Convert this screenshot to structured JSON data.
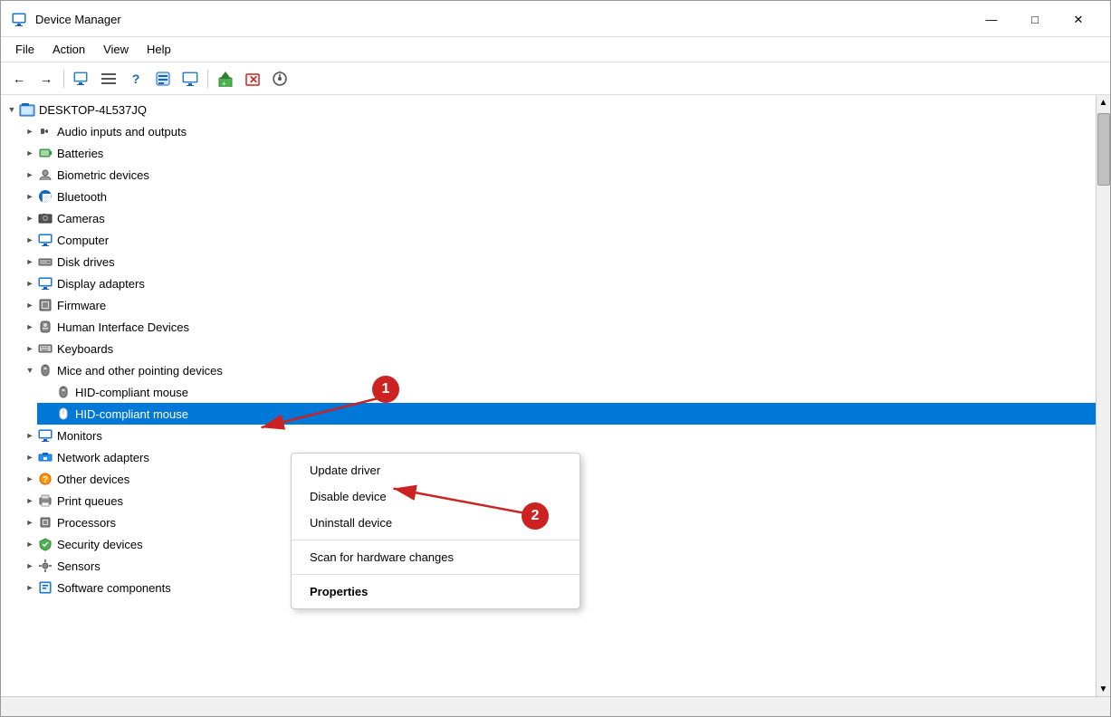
{
  "window": {
    "title": "Device Manager",
    "controls": {
      "minimize": "—",
      "maximize": "□",
      "close": "✕"
    }
  },
  "menu": {
    "items": [
      "File",
      "Action",
      "View",
      "Help"
    ]
  },
  "tree": {
    "root": "DESKTOP-4L537JQ",
    "items": [
      {
        "id": "audio",
        "label": "Audio inputs and outputs",
        "level": 1,
        "expanded": false,
        "icon": "🔊"
      },
      {
        "id": "batteries",
        "label": "Batteries",
        "level": 1,
        "expanded": false,
        "icon": "🔋"
      },
      {
        "id": "biometric",
        "label": "Biometric devices",
        "level": 1,
        "expanded": false,
        "icon": "🖐"
      },
      {
        "id": "bluetooth",
        "label": "Bluetooth",
        "level": 1,
        "expanded": false,
        "icon": "🔵"
      },
      {
        "id": "cameras",
        "label": "Cameras",
        "level": 1,
        "expanded": false,
        "icon": "📷"
      },
      {
        "id": "computer",
        "label": "Computer",
        "level": 1,
        "expanded": false,
        "icon": "💻"
      },
      {
        "id": "disk",
        "label": "Disk drives",
        "level": 1,
        "expanded": false,
        "icon": "💾"
      },
      {
        "id": "display",
        "label": "Display adapters",
        "level": 1,
        "expanded": false,
        "icon": "🖥"
      },
      {
        "id": "firmware",
        "label": "Firmware",
        "level": 1,
        "expanded": false,
        "icon": "🔧"
      },
      {
        "id": "hid",
        "label": "Human Interface Devices",
        "level": 1,
        "expanded": false,
        "icon": "🎮"
      },
      {
        "id": "keyboards",
        "label": "Keyboards",
        "level": 1,
        "expanded": false,
        "icon": "⌨"
      },
      {
        "id": "mice",
        "label": "Mice and other pointing devices",
        "level": 1,
        "expanded": true,
        "icon": "🖱"
      },
      {
        "id": "mouse1",
        "label": "HID-compliant mouse",
        "level": 2,
        "expanded": false,
        "icon": "🖱"
      },
      {
        "id": "mouse2",
        "label": "HID-compliant mouse",
        "level": 2,
        "expanded": false,
        "icon": "🖱",
        "selected": true
      },
      {
        "id": "monitors",
        "label": "Monitors",
        "level": 1,
        "expanded": false,
        "icon": "🖥"
      },
      {
        "id": "network",
        "label": "Network adapters",
        "level": 1,
        "expanded": false,
        "icon": "🌐"
      },
      {
        "id": "other",
        "label": "Other devices",
        "level": 1,
        "expanded": false,
        "icon": "❓"
      },
      {
        "id": "print",
        "label": "Print queues",
        "level": 1,
        "expanded": false,
        "icon": "🖨"
      },
      {
        "id": "processors",
        "label": "Processors",
        "level": 1,
        "expanded": false,
        "icon": "🔲"
      },
      {
        "id": "security",
        "label": "Security devices",
        "level": 1,
        "expanded": false,
        "icon": "🔒"
      },
      {
        "id": "sensors",
        "label": "Sensors",
        "level": 1,
        "expanded": false,
        "icon": "📡"
      },
      {
        "id": "software",
        "label": "Software components",
        "level": 1,
        "expanded": false,
        "icon": "📦"
      }
    ]
  },
  "context_menu": {
    "items": [
      {
        "id": "update",
        "label": "Update driver",
        "bold": false
      },
      {
        "id": "disable",
        "label": "Disable device",
        "bold": false
      },
      {
        "id": "uninstall",
        "label": "Uninstall device",
        "bold": false
      },
      {
        "id": "scan",
        "label": "Scan for hardware changes",
        "bold": false
      },
      {
        "id": "properties",
        "label": "Properties",
        "bold": true
      }
    ]
  },
  "badges": {
    "badge1": "1",
    "badge2": "2"
  }
}
